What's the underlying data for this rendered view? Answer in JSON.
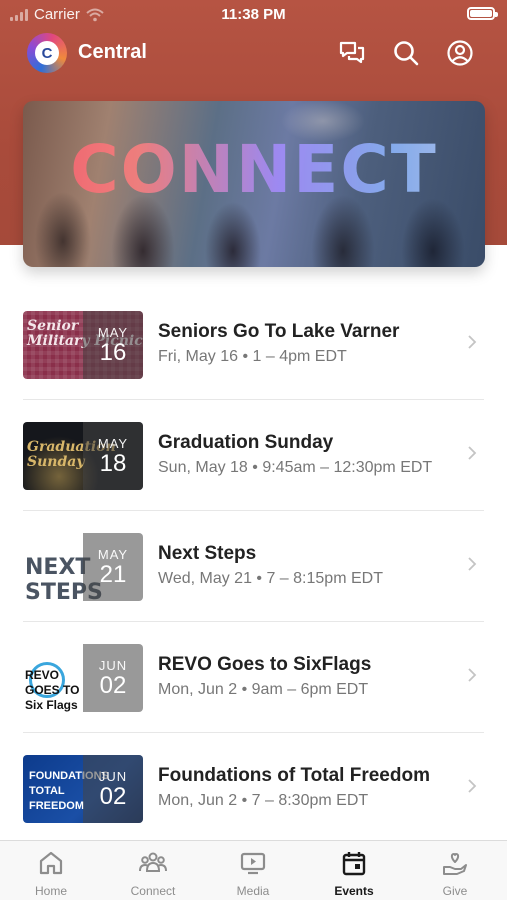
{
  "status_bar": {
    "carrier": "Carrier",
    "time": "11:38 PM",
    "battery_level": 1.0
  },
  "app_bar": {
    "title": "Central",
    "logo_letter": "C",
    "icons": [
      "chat-icon",
      "search-icon",
      "profile-icon"
    ]
  },
  "banner": {
    "text": "CONNECT"
  },
  "events": [
    {
      "title": "Seniors Go To Lake Varner",
      "meta": "Fri, May 16 • 1 – 4pm EDT",
      "month": "MAY",
      "day": "16",
      "thumb_text": "Senior Military Picnic"
    },
    {
      "title": "Graduation Sunday",
      "meta": "Sun, May 18 • 9:45am – 12:30pm EDT",
      "month": "MAY",
      "day": "18",
      "thumb_text": "Graduation Sunday"
    },
    {
      "title": "Next Steps",
      "meta": "Wed, May 21 • 7 – 8:15pm EDT",
      "month": "MAY",
      "day": "21",
      "thumb_text": "NEXT STEPS"
    },
    {
      "title": "REVO Goes to SixFlags",
      "meta": "Mon, Jun 2 • 9am – 6pm EDT",
      "month": "JUN",
      "day": "02",
      "thumb_text": "REVO GOES TO Six Flags"
    },
    {
      "title": "Foundations of Total Freedom",
      "meta": "Mon, Jun 2 • 7 – 8:30pm EDT",
      "month": "JUN",
      "day": "02",
      "thumb_text": "FOUNDATIONS TOTAL FREEDOM"
    }
  ],
  "tabs": [
    {
      "label": "Home",
      "icon": "home-icon",
      "active": false
    },
    {
      "label": "Connect",
      "icon": "people-icon",
      "active": false
    },
    {
      "label": "Media",
      "icon": "media-icon",
      "active": false
    },
    {
      "label": "Events",
      "icon": "calendar-icon",
      "active": true
    },
    {
      "label": "Give",
      "icon": "give-icon",
      "active": false
    }
  ],
  "colors": {
    "header": "#b65443",
    "accent": "#1a1a1a",
    "inactive_tab": "#8d8d8d"
  }
}
